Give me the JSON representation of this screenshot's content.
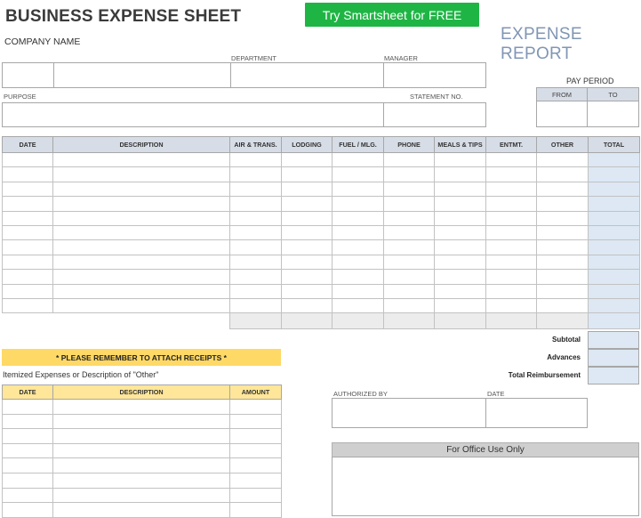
{
  "header": {
    "title": "BUSINESS EXPENSE SHEET",
    "cta_label": "Try Smartsheet for FREE",
    "report_title": "EXPENSE REPORT",
    "company_label": "COMPANY NAME"
  },
  "fields": {
    "department_label": "DEPARTMENT",
    "manager_label": "MANAGER",
    "purpose_label": "PURPOSE",
    "statement_label": "STATEMENT NO."
  },
  "pay_period": {
    "label": "PAY PERIOD",
    "from_label": "FROM",
    "to_label": "TO"
  },
  "expense_table": {
    "columns": [
      "DATE",
      "DESCRIPTION",
      "AIR & TRANS.",
      "LODGING",
      "FUEL / MLG.",
      "PHONE",
      "MEALS & TIPS",
      "ENTMT.",
      "OTHER",
      "TOTAL"
    ]
  },
  "summary": {
    "subtotal_label": "Subtotal",
    "advances_label": "Advances",
    "total_label": "Total Reimbursement"
  },
  "receipts": {
    "notice": "* PLEASE REMEMBER TO ATTACH RECEIPTS *",
    "itemized_label": "Itemized Expenses or Description of \"Other\"",
    "columns": [
      "DATE",
      "DESCRIPTION",
      "AMOUNT"
    ]
  },
  "authorization": {
    "authorized_label": "AUTHORIZED BY",
    "date_label": "DATE"
  },
  "office": {
    "label": "For Office Use Only"
  },
  "colors": {
    "header_fill": "#d7dde6",
    "total_fill": "#dde8f4",
    "receipt_notice": "#ffd966",
    "receipt_header": "#ffe699",
    "cta_green": "#1fb545",
    "report_title": "#8096b4"
  }
}
